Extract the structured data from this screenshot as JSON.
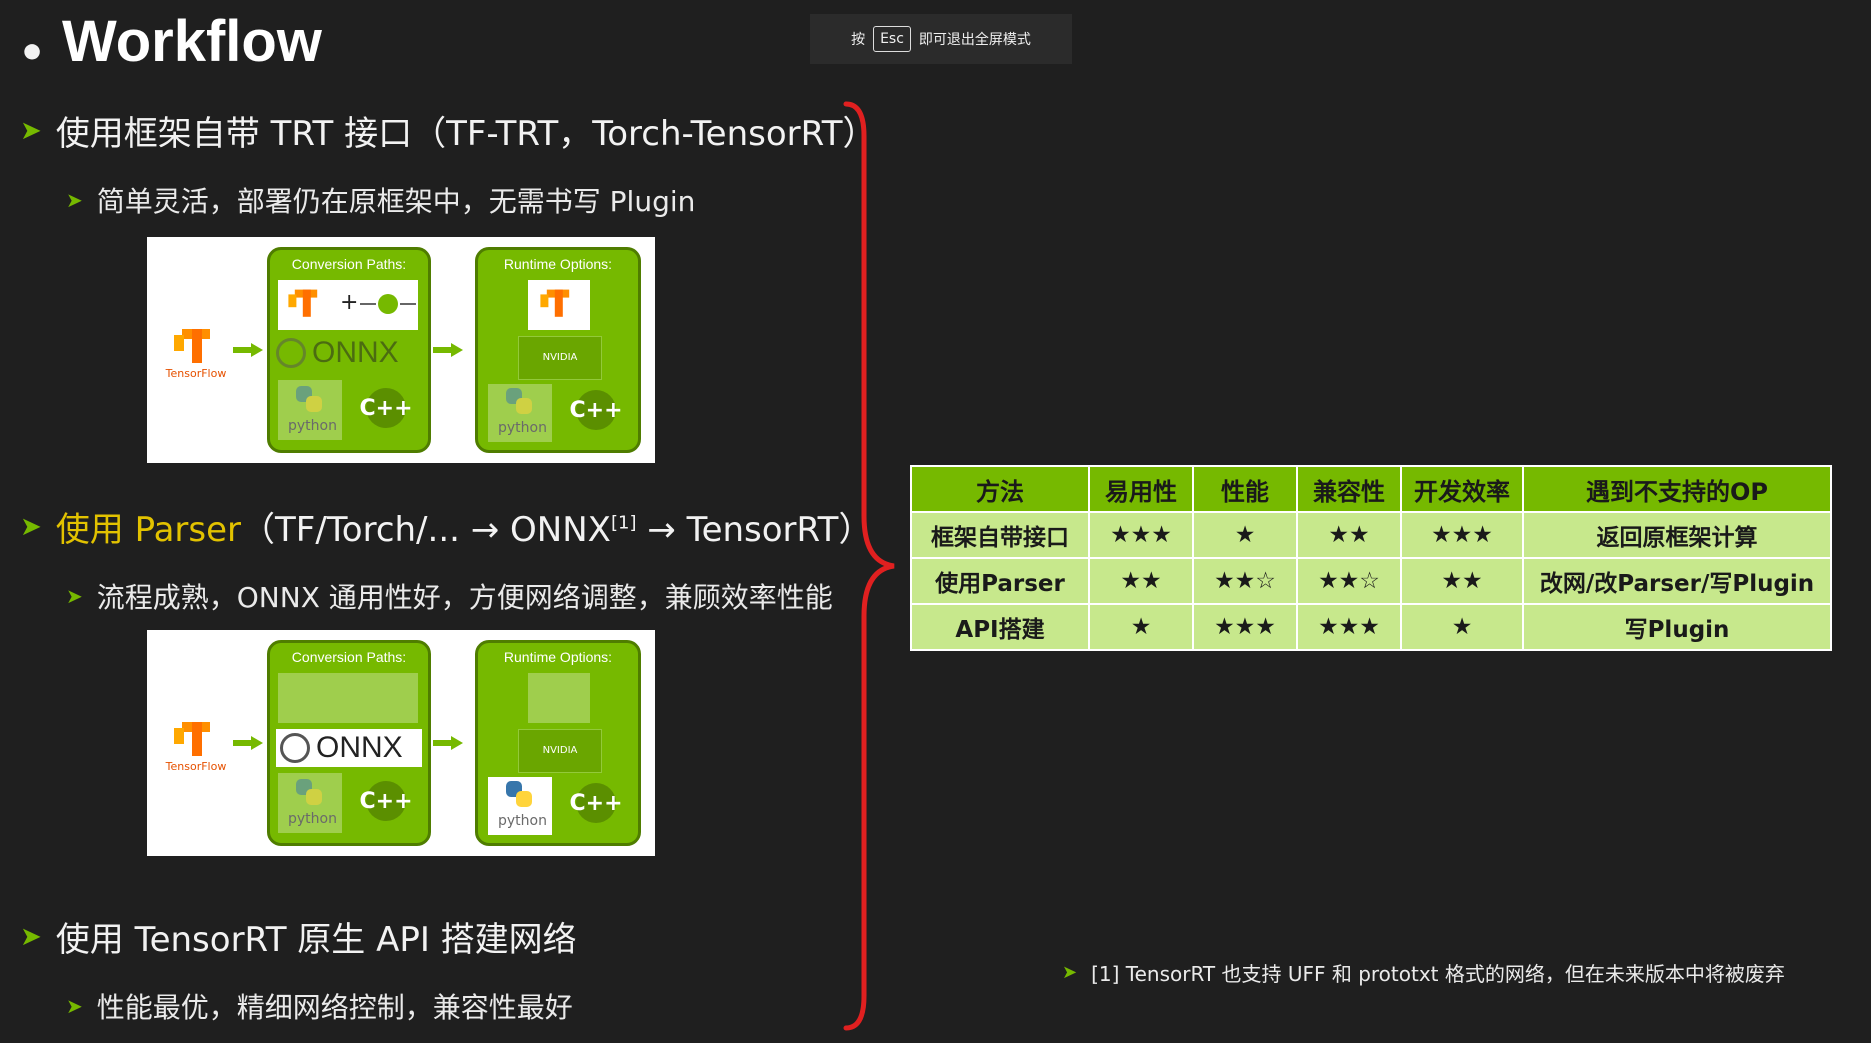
{
  "header": {
    "bullet": "•",
    "title": "Workflow"
  },
  "esc_notice": {
    "prefix": "按",
    "key": "Esc",
    "suffix": "即可退出全屏模式"
  },
  "bullets": [
    {
      "title": "使用框架自带 TRT 接口（TF-TRT，Torch-TensorRT）",
      "sub": "简单灵活，部署仍在原框架中，无需书写 Plugin"
    },
    {
      "title_prefix": "使用 Parser",
      "title_mid": "（TF/Torch/... → ONNX",
      "title_sup": "[1]",
      "title_suffix": " → TensorRT）",
      "sub": "流程成熟，ONNX 通用性好，方便网络调整，兼顾效率性能"
    },
    {
      "title": "使用 TensorRT 原生 API 搭建网络",
      "sub": "性能最优，精细网络控制，兼容性最好"
    }
  ],
  "diagram": {
    "tensorflow_label": "TensorFlow",
    "conversion_title": "Conversion Paths:",
    "runtime_title": "Runtime Options:",
    "onnx_label": "ONNX",
    "python_label": "python",
    "cpp_label": "C++",
    "nvidia_label": "NVIDIA",
    "plus": "+"
  },
  "table": {
    "headers": [
      "方法",
      "易用性",
      "性能",
      "兼容性",
      "开发效率",
      "遇到不支持的OP"
    ],
    "rows": [
      [
        "框架自带接口",
        "★★★",
        "★",
        "★★",
        "★★★",
        "返回原框架计算"
      ],
      [
        "使用Parser",
        "★★",
        "★★☆",
        "★★☆",
        "★★",
        "改网/改Parser/写Plugin"
      ],
      [
        "API搭建",
        "★",
        "★★★",
        "★★★",
        "★",
        "写Plugin"
      ]
    ]
  },
  "footnote": "[1] TensorRT 也支持 UFF 和 prototxt 格式的网络，但在未来版本中将被废弃",
  "colors": {
    "nvidia_green": "#76b900",
    "table_cell": "#c7e88c",
    "brace_red": "#e02020",
    "highlight": "#e2c200"
  },
  "arrow_glyph": "➤"
}
